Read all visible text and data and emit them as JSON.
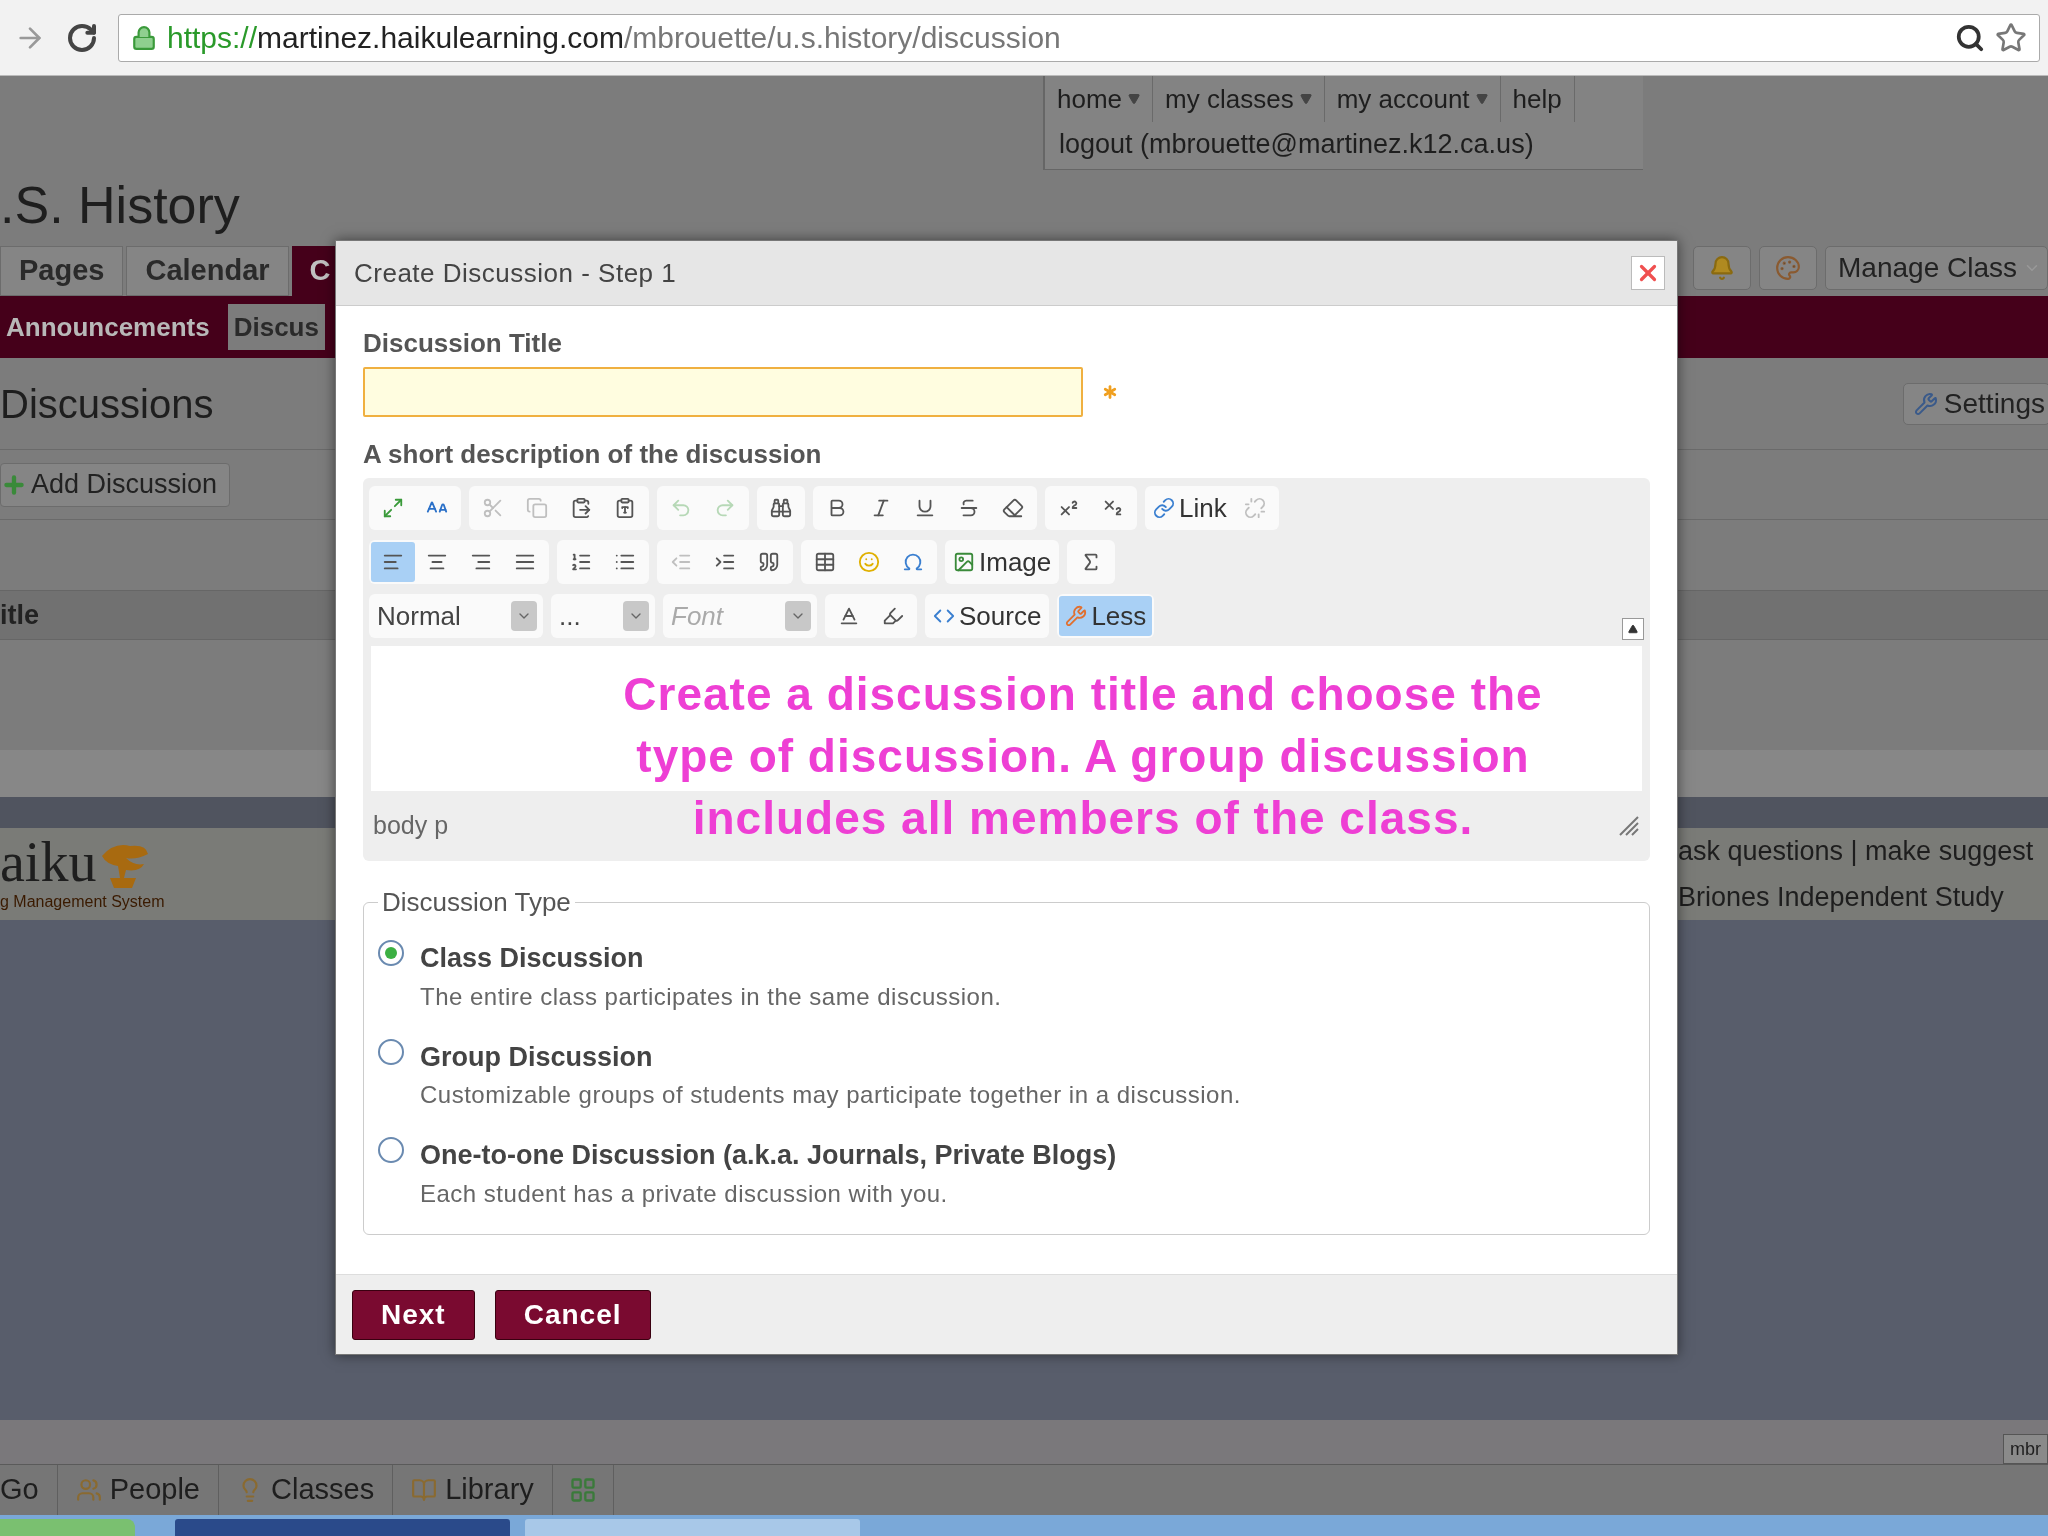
{
  "browser": {
    "url_scheme": "https://",
    "url_host": "martinez.haikulearning.com",
    "url_path": "/mbrouette/u.s.history/discussion"
  },
  "top_nav": {
    "items": [
      {
        "label": "home",
        "has_menu": true
      },
      {
        "label": "my classes",
        "has_menu": true
      },
      {
        "label": "my account",
        "has_menu": true
      },
      {
        "label": "help",
        "has_menu": false
      }
    ],
    "logout": "logout (mbrouette@martinez.k12.ca.us)"
  },
  "site_title": ".S. History",
  "tabs": [
    {
      "label": "Pages",
      "selected": false
    },
    {
      "label": "Calendar",
      "selected": false
    },
    {
      "label": "C",
      "selected": true
    }
  ],
  "manage_button": "Manage Class",
  "subtabs": [
    {
      "label": "Announcements",
      "selected": false
    },
    {
      "label": "Discus",
      "selected": true
    }
  ],
  "heading": "Discussions",
  "settings_button": "Settings",
  "add_button": "Add Discussion",
  "table": {
    "columns": [
      "itle"
    ]
  },
  "footer": {
    "logo": "aiku",
    "tagline": "g Management System",
    "links": "ask questions | make suggest",
    "school": "Briones Independent Study"
  },
  "bottom_bar": {
    "items": [
      {
        "label": "Go"
      },
      {
        "label": "People"
      },
      {
        "label": "Classes"
      },
      {
        "label": "Library"
      }
    ],
    "tab": "mbr"
  },
  "dialog": {
    "title": "Create Discussion - Step 1",
    "title_label": "Discussion Title",
    "description_label": "A short description of the discussion",
    "editor": {
      "toolbar": [
        [
          [
            {
              "kind": "icon",
              "selected": false,
              "disabled": false
            },
            {
              "kind": "icon",
              "selected": false,
              "disabled": false
            }
          ],
          [
            {
              "kind": "icon",
              "selected": false,
              "disabled": true
            },
            {
              "kind": "icon",
              "selected": false,
              "disabled": true
            },
            {
              "kind": "icon",
              "selected": false,
              "disabled": false
            },
            {
              "kind": "icon",
              "selected": false,
              "disabled": false
            }
          ],
          [
            {
              "kind": "icon",
              "selected": false,
              "disabled": true
            },
            {
              "kind": "icon",
              "selected": false,
              "disabled": true
            }
          ],
          [
            {
              "kind": "icon",
              "selected": false,
              "disabled": false
            }
          ],
          [
            {
              "kind": "icon",
              "selected": false,
              "disabled": false
            },
            {
              "kind": "icon",
              "selected": false,
              "disabled": false
            },
            {
              "kind": "icon",
              "selected": false,
              "disabled": false
            },
            {
              "kind": "icon",
              "selected": false,
              "disabled": false
            },
            {
              "kind": "icon",
              "selected": false,
              "disabled": false
            }
          ],
          [
            {
              "kind": "icon",
              "selected": false,
              "disabled": false
            },
            {
              "kind": "icon",
              "selected": false,
              "disabled": false
            }
          ],
          [
            {
              "kind": "text",
              "label": "Link",
              "selected": false,
              "disabled": false
            },
            {
              "kind": "icon",
              "selected": false,
              "disabled": true
            }
          ]
        ],
        [
          [
            {
              "kind": "icon",
              "selected": true,
              "disabled": false
            },
            {
              "kind": "icon",
              "selected": false,
              "disabled": false
            },
            {
              "kind": "icon",
              "selected": false,
              "disabled": false
            },
            {
              "kind": "icon",
              "selected": false,
              "disabled": false
            }
          ],
          [
            {
              "kind": "icon",
              "selected": false,
              "disabled": false
            },
            {
              "kind": "icon",
              "selected": false,
              "disabled": false
            }
          ],
          [
            {
              "kind": "icon",
              "selected": false,
              "disabled": true
            },
            {
              "kind": "icon",
              "selected": false,
              "disabled": false
            },
            {
              "kind": "icon",
              "selected": false,
              "disabled": false
            }
          ],
          [
            {
              "kind": "icon",
              "selected": false,
              "disabled": false
            },
            {
              "kind": "icon",
              "selected": false,
              "disabled": false
            },
            {
              "kind": "icon",
              "selected": false,
              "disabled": false
            }
          ],
          [
            {
              "kind": "text",
              "label": "Image",
              "selected": false,
              "disabled": false
            }
          ],
          [
            {
              "kind": "icon",
              "selected": false,
              "disabled": false
            }
          ]
        ],
        [
          [
            {
              "kind": "select",
              "value": "Normal",
              "selected": false,
              "disabled": false
            }
          ],
          [
            {
              "kind": "select",
              "value": "...",
              "selected": false,
              "disabled": false
            }
          ],
          [
            {
              "kind": "select",
              "placeholder": "Font",
              "selected": false,
              "disabled": false
            }
          ],
          [
            {
              "kind": "icon",
              "selected": false,
              "disabled": false
            },
            {
              "kind": "icon",
              "selected": false,
              "disabled": false
            }
          ],
          [
            {
              "kind": "text",
              "label": "Source",
              "selected": false,
              "disabled": false
            }
          ],
          [
            {
              "kind": "text",
              "label": "Less",
              "selected": true,
              "disabled": false
            }
          ]
        ]
      ],
      "path": "body p",
      "annotation": [
        "Create a discussion title and choose the",
        "type of discussion.  A group discussion",
        "includes all members of the class."
      ]
    },
    "type": {
      "legend": "Discussion Type",
      "options": [
        {
          "title": "Class Discussion",
          "description": "The entire class participates in the same discussion.",
          "selected": true
        },
        {
          "title": "Group Discussion",
          "description": "Customizable groups of students may participate together in a discussion.",
          "selected": false
        },
        {
          "title": "One-to-one Discussion (a.k.a. Journals, Private Blogs)",
          "description": "Each student has a private discussion with you.",
          "selected": false
        }
      ]
    },
    "buttons": [
      "Next",
      "Cancel"
    ]
  }
}
